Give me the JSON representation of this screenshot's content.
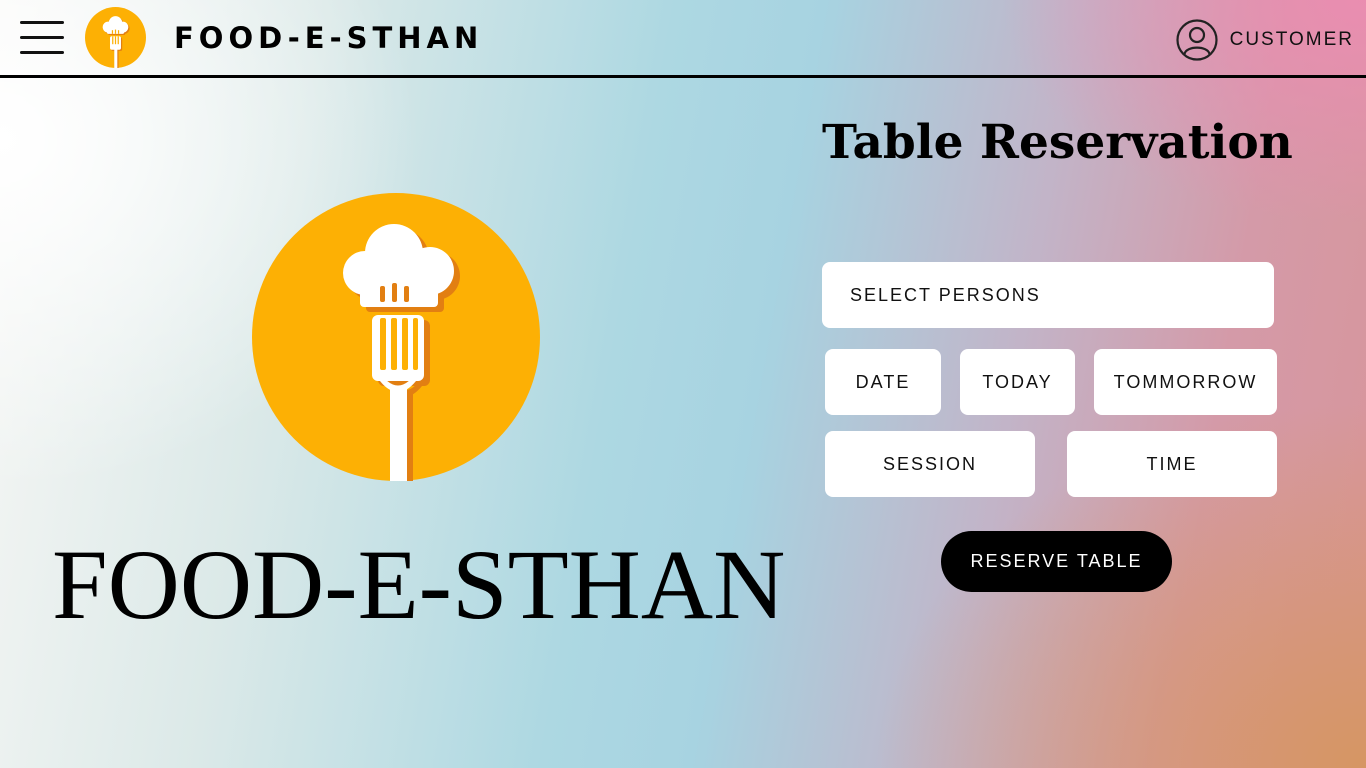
{
  "header": {
    "brand": "FOOD-E-STHAN",
    "user_label": "CUSTOMER",
    "menu_icon": "hamburger-menu-icon",
    "logo_icon": "chef-hat-fork-logo",
    "user_icon": "user-circle-icon"
  },
  "hero": {
    "title": "FOOD-E-STHAN",
    "logo_icon": "chef-hat-fork-logo"
  },
  "reservation": {
    "title": "Table Reservation",
    "select_persons": "SELECT PERSONS",
    "date": "DATE",
    "today": "TODAY",
    "tomorrow": "TOMMORROW",
    "session": "SESSION",
    "time": "TIME",
    "submit": "RESERVE TABLE"
  },
  "colors": {
    "logo_orange": "#FDB004",
    "logo_shadow": "#E27F12",
    "button_black": "#000000",
    "field_white": "#FFFFFF"
  }
}
